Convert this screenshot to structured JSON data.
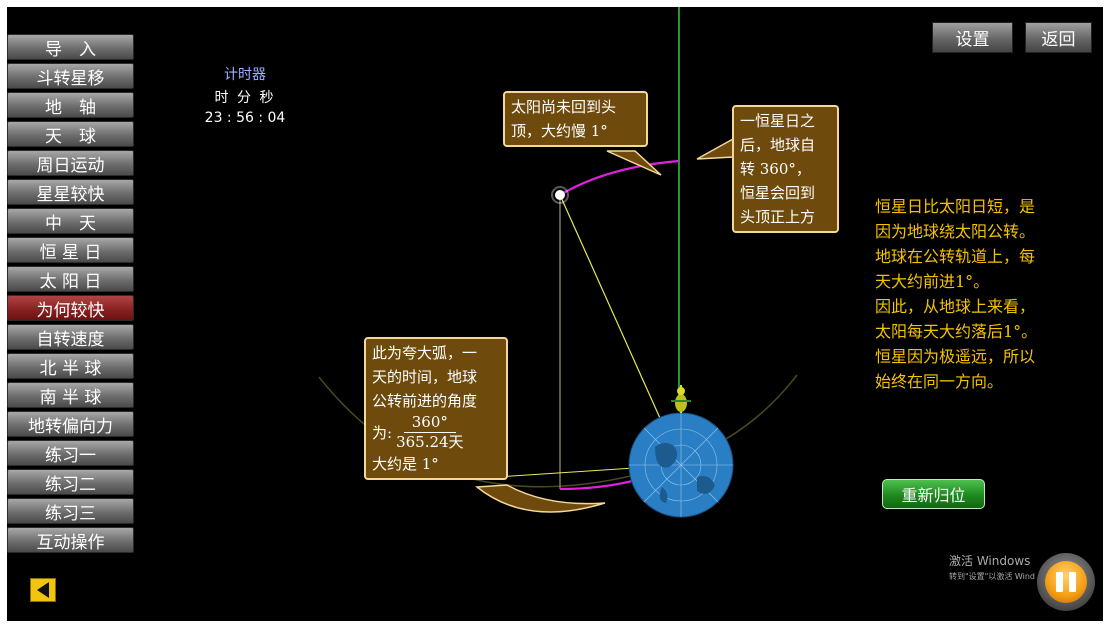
{
  "sidebar": {
    "items": [
      {
        "label": "导　入",
        "active": false
      },
      {
        "label": "斗转星移",
        "active": false
      },
      {
        "label": "地　轴",
        "active": false
      },
      {
        "label": "天　球",
        "active": false
      },
      {
        "label": "周日运动",
        "active": false
      },
      {
        "label": "星星较快",
        "active": false
      },
      {
        "label": "中　天",
        "active": false
      },
      {
        "label": "恒 星 日",
        "active": false
      },
      {
        "label": "太 阳 日",
        "active": false
      },
      {
        "label": "为何较快",
        "active": true
      },
      {
        "label": "自转速度",
        "active": false
      },
      {
        "label": "北 半 球",
        "active": false
      },
      {
        "label": "南 半 球",
        "active": false
      },
      {
        "label": "地转偏向力",
        "active": false
      },
      {
        "label": "练习一",
        "active": false
      },
      {
        "label": "练习二",
        "active": false
      },
      {
        "label": "练习三",
        "active": false
      },
      {
        "label": "互动操作",
        "active": false
      }
    ]
  },
  "timer": {
    "title": "计时器",
    "units": "时 分 秒",
    "value": "23 : 56 : 04"
  },
  "top_buttons": {
    "settings": "设置",
    "back": "返回"
  },
  "callouts": {
    "sun_not_overhead": [
      "太阳尚未回到头",
      "顶，大约慢 1°"
    ],
    "after_sidereal_day": [
      "一恒星日之",
      "后，地球自",
      "转 360°，",
      "恒星会回到",
      "头顶正上方"
    ],
    "arc_exaggerated": {
      "lines": [
        "此为夸大弧，一",
        "天的时间，地球",
        "公转前进的角度"
      ],
      "formula_prefix": "为:",
      "numerator": "360°",
      "denominator": "365.24天",
      "last_line": "大约是 1°"
    }
  },
  "explanation": [
    "恒星日比太阳日短，是",
    "因为地球绕太阳公转。",
    "地球在公转轨道上，每",
    "天大约前进1°。",
    "因此，从地球上来看，",
    "太阳每天大约落后1°。",
    "恒星因为极遥远，所以",
    "始终在同一方向。"
  ],
  "reset_button": "重新归位",
  "watermark": {
    "title": "激活 Windows",
    "subtitle": "转到\"设置\"以激活 Wind"
  },
  "colors": {
    "background": "#000000",
    "accent_text": "#f5c200",
    "arc": "#e020e0",
    "meridian": "#2ecc40",
    "pointer_lines": "#e8e85a",
    "earth": "#2a7fc4"
  },
  "icons": {
    "back_arrow": "back-arrow-icon",
    "pause": "pause-icon",
    "earth": "earth-globe-icon",
    "observer": "observer-figure-icon",
    "star": "star-dot-icon"
  }
}
